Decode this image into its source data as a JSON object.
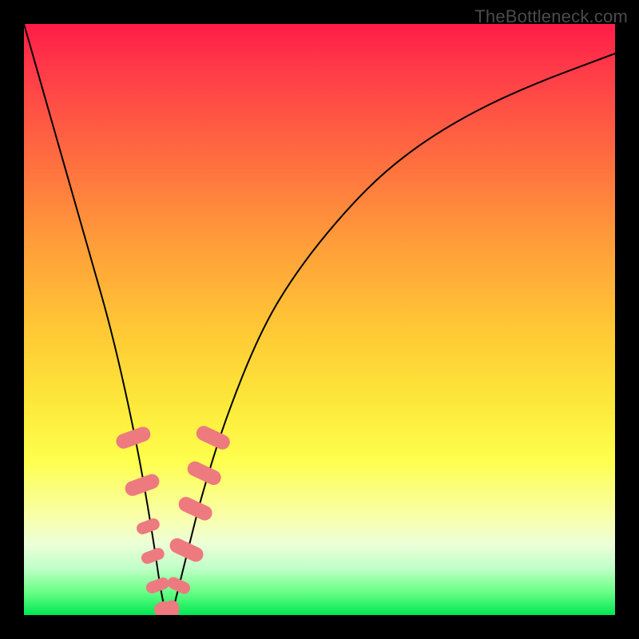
{
  "watermark": "TheBottleneck.com",
  "chart_data": {
    "type": "line",
    "title": "",
    "xlabel": "",
    "ylabel": "",
    "xlim": [
      0,
      100
    ],
    "ylim": [
      0,
      100
    ],
    "series": [
      {
        "name": "bottleneck-curve",
        "x": [
          0,
          2,
          4,
          6,
          8,
          10,
          12,
          14,
          16,
          18,
          20,
          22,
          23,
          24,
          25,
          26,
          28,
          30,
          34,
          40,
          46,
          54,
          62,
          72,
          84,
          100
        ],
        "y": [
          100,
          93,
          86,
          79,
          72,
          65,
          58,
          51,
          43,
          34,
          24,
          12,
          5,
          0,
          0,
          4,
          12,
          20,
          33,
          48,
          58,
          68,
          76,
          83,
          89,
          95
        ]
      }
    ],
    "markers": {
      "name": "highlight-points",
      "color": "#ed7a7f",
      "points": [
        {
          "x": 18.5,
          "y": 30,
          "w": 2.5,
          "h": 6
        },
        {
          "x": 20.0,
          "y": 22,
          "w": 2.5,
          "h": 6
        },
        {
          "x": 21.0,
          "y": 15,
          "w": 2.0,
          "h": 4
        },
        {
          "x": 21.8,
          "y": 10,
          "w": 2.0,
          "h": 4
        },
        {
          "x": 22.6,
          "y": 5,
          "w": 2.0,
          "h": 4
        },
        {
          "x": 23.5,
          "y": 1,
          "w": 2.5,
          "h": 3
        },
        {
          "x": 25.0,
          "y": 1,
          "w": 2.5,
          "h": 3
        },
        {
          "x": 26.2,
          "y": 5,
          "w": 2.0,
          "h": 4
        },
        {
          "x": 27.5,
          "y": 11,
          "w": 2.5,
          "h": 6
        },
        {
          "x": 29.0,
          "y": 18,
          "w": 2.5,
          "h": 6
        },
        {
          "x": 30.5,
          "y": 24,
          "w": 2.5,
          "h": 6
        },
        {
          "x": 32.0,
          "y": 30,
          "w": 2.5,
          "h": 6
        }
      ]
    }
  }
}
